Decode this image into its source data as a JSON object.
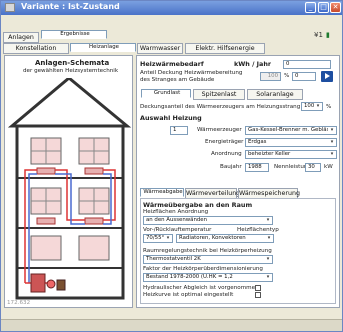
{
  "window": {
    "title": "Variante : Ist-Zustand",
    "buttons": [
      "_",
      "□",
      "✕"
    ]
  },
  "menu_tabs": {
    "row1": [
      "Anlagen",
      "Ergebnisse"
    ],
    "row2": [
      "Konstellation",
      "Heizanlage",
      "Warmwasser",
      "Elektr. Hilfsenergie"
    ]
  },
  "toolbar": {
    "icon1": "¥1",
    "icon2": "▮"
  },
  "left": {
    "title": "Anlagen-Schemata",
    "subtitle": "der gewählten Heizsystemtechnik",
    "footer_number": "172.632"
  },
  "right": {
    "heizwaermebedarf_label": "Heizwärmebedarf",
    "unit_label": "kWh / Jahr",
    "heizwaermebedarf_value": "0",
    "anteil_label_line1": "Anteil Deckung Heizwärmebereitung",
    "anteil_label_line2": "des Stranges am Gebäude",
    "anteil_value": "100",
    "percent_sign": "%",
    "anteil_other": "0",
    "subtabs": [
      "Grundlast",
      "Spitzenlast",
      "Solaranlage"
    ],
    "deckungsanteil_label": "Deckungsanteil des Wärmeerzeugers am Heizungsstrang",
    "deckungsanteil_value": "100",
    "auswahl_header": "Auswahl Heizung",
    "auswahl_number": "1",
    "waermeerzeuger_label": "Wärmeerzeuger",
    "waermeerzeuger_value": "Gas-Kessel-Brenner m. Gebläse",
    "energietraeger_label": "Energieträger",
    "energietraeger_value": "Erdgas",
    "anordnung_label": "Anordnung",
    "anordnung_value": "beheizter Keller",
    "baujahr_label": "Baujahr",
    "baujahr_value": "1988",
    "nennleistung_label": "Nennleistung",
    "nennleistung_value": "30",
    "nennleistung_unit": "kW",
    "bottom_tabs": [
      "Wärmeabgabe",
      "Wärmeverteilung",
      "Wärmespeicherung"
    ],
    "waermeabgabe_header": "Wärmeübergabe an den Raum",
    "heizflaechen_anordnung_label": "Heizflächen Anordnung",
    "heizflaechen_anordnung_value": "an den Aussenwänden",
    "vorlauf_label": "Vor-/Rücklauftemperatur",
    "heizflaechentyp_label": "Heizflächentyp",
    "vorlauf_value": "70/55°C",
    "heizflaechentyp_value": "Radiatoren, Konvektoren",
    "raumregelung_label": "Raumregelungstechnik bei Heizkörperheizung",
    "raumregelung_value": "Thermostatventil 2K",
    "faktor_label": "Faktor der Heizkörperüberdimensionierung",
    "faktor_value": "Bestand 1978-2000 (Ü.HK = 1,2",
    "hydraulisch_label": "Hydraulischer Abgleich ist vorgenommen",
    "heizkurve_label": "Heizkurve ist optimal eingestellt"
  }
}
